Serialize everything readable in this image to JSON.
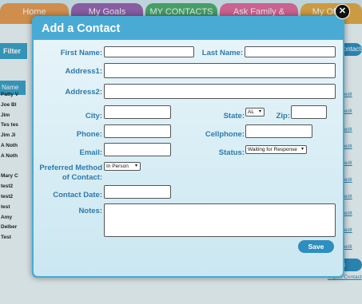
{
  "background": {
    "tabs": [
      {
        "label": "Home",
        "color": "#e58f3a"
      },
      {
        "label": "My Goals",
        "color": "#8c4fa6"
      },
      {
        "label": "MY CONTACTS",
        "color": "#36a35a"
      },
      {
        "label": "Ask Family & Friends",
        "color": "#e0568f"
      },
      {
        "label": "My Offers",
        "color": "#e09f2e"
      }
    ],
    "filter_label": "Filter",
    "contacts_pill_top": "Contacts",
    "name_header": "Name",
    "names": [
      "Patty V",
      "Joe Bl",
      "Jim",
      "Tes tes",
      "Jim Ji",
      "A Noth",
      "A Noth",
      "",
      "Mary C",
      "test2",
      "test2",
      "test",
      "Amy",
      "Delber",
      "Test"
    ],
    "edit_label": "edit",
    "contacts_pill_bottom": "Contacts",
    "import_link": "Import Contact"
  },
  "modal": {
    "title": "Add a Contact",
    "close_glyph": "✕",
    "fields": {
      "first_name_label": "First Name:",
      "last_name_label": "Last Name:",
      "address1_label": "Address1:",
      "address2_label": "Address2:",
      "city_label": "City:",
      "state_label": "State:",
      "state_value": "AL",
      "zip_label": "Zip:",
      "phone_label": "Phone:",
      "cellphone_label": "Cellphone:",
      "email_label": "Email:",
      "status_label": "Status:",
      "status_value": "Waiting for Response",
      "pref_method_label_1": "Preferred Method",
      "pref_method_label_2": "of Contact:",
      "pref_method_value": "In Person",
      "contact_date_label": "Contact Date:",
      "notes_label": "Notes:"
    },
    "save_label": "Save"
  },
  "colors": {
    "modal_header": "#49abd4",
    "label": "#2d79ad",
    "button": "#2e8fbe"
  }
}
